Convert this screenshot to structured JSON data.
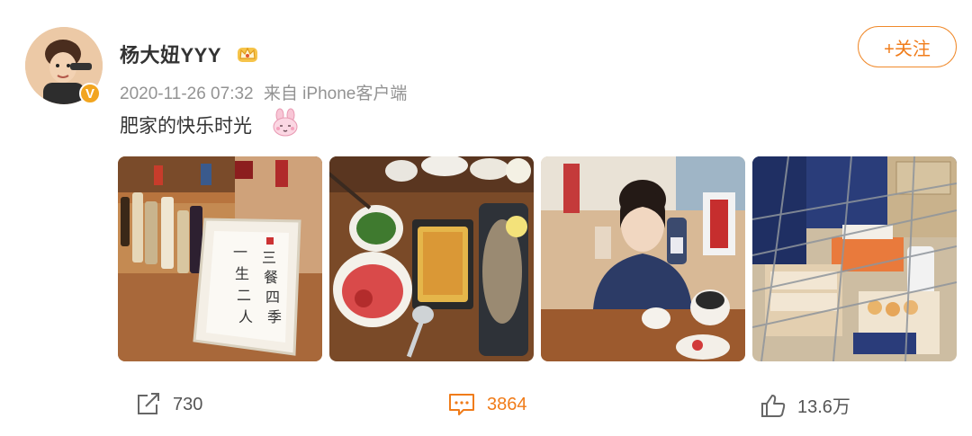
{
  "post": {
    "username": "杨大妞YYY",
    "timestamp": "2020-11-26 07:32",
    "source": "来自 iPhone客户端",
    "text": "肥家的快乐时光",
    "follow_label": "+关注",
    "verified_badge": "V"
  },
  "icons": {
    "crown": "crown-icon",
    "emoji": "bunny-emoji-icon",
    "share": "share-icon",
    "comment": "comment-icon",
    "like": "like-icon"
  },
  "images": [
    {
      "name": "shelf-calligraphy-photo",
      "text": "三餐四季 一生二人"
    },
    {
      "name": "dinner-table-photo"
    },
    {
      "name": "woman-drink-photo"
    },
    {
      "name": "shopping-cart-photo"
    }
  ],
  "actions": {
    "share_count": "730",
    "comment_count": "3864",
    "like_count": "13.6万"
  },
  "colors": {
    "accent": "#f07c1a",
    "username": "#333333",
    "meta": "#939393"
  }
}
